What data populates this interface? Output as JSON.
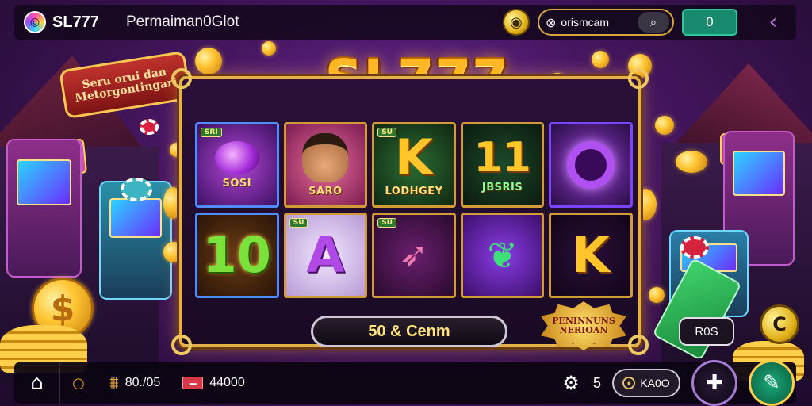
{
  "header": {
    "brand": "SL777",
    "game_title": "Permaiman0Glot",
    "username": "orismcam",
    "balance": "0"
  },
  "ribbon": {
    "line1": "Seru orui dan",
    "line2": "Metorgontingari"
  },
  "game": {
    "logo": "SL777",
    "bet_text": "50 & Cenm",
    "badge_line1": "PENINNUNS",
    "badge_line2": "NERIOAN",
    "side_button": "R0S"
  },
  "reels": [
    {
      "tag": "SRI",
      "symbol": "",
      "label": "SOSI",
      "kind": "emblem"
    },
    {
      "tag": "",
      "symbol": "",
      "label": "SARO",
      "kind": "face"
    },
    {
      "tag": "SU",
      "symbol": "K",
      "label": "LODHGEY",
      "kind": "letter"
    },
    {
      "tag": "",
      "symbol": "11",
      "label": "JBSRIS",
      "kind": "letter"
    },
    {
      "tag": "",
      "symbol": "",
      "label": "",
      "kind": "ring"
    },
    {
      "tag": "",
      "symbol": "10",
      "label": "",
      "kind": "letter"
    },
    {
      "tag": "SU",
      "symbol": "A",
      "label": "",
      "kind": "letter"
    },
    {
      "tag": "SU",
      "symbol": "",
      "label": "",
      "kind": "fish"
    },
    {
      "tag": "",
      "symbol": "",
      "label": "",
      "kind": "leaf"
    },
    {
      "tag": "",
      "symbol": "K",
      "label": "",
      "kind": "letter"
    }
  ],
  "footer": {
    "stat1": "80./05",
    "stat2": "44000",
    "count": "5",
    "pill": "KA0O"
  },
  "colors": {
    "accent_gold": "#e4b04a",
    "balance_green": "#1a8a6e",
    "background_purple": "#45165f"
  },
  "icons": {
    "home": "home-icon",
    "search": "search-icon",
    "bank": "bank-icon",
    "card": "card-icon",
    "gear": "gear-icon",
    "puzzle": "puzzle-icon",
    "chat": "chat-icon"
  }
}
